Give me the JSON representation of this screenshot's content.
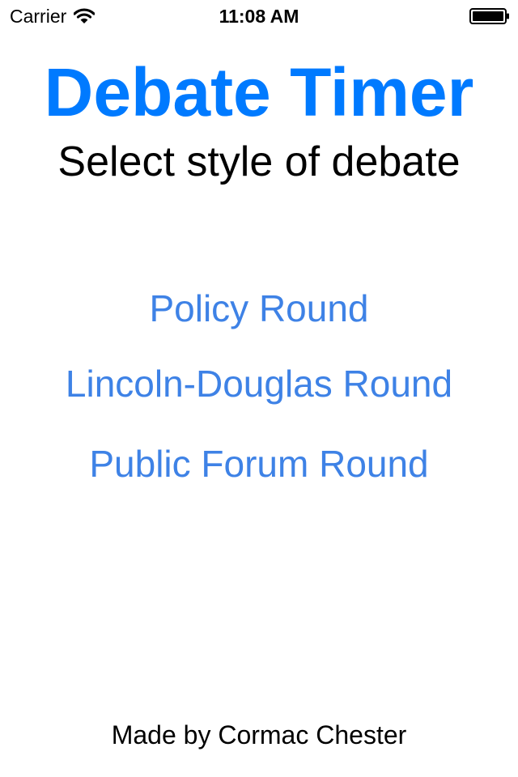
{
  "status_bar": {
    "carrier": "Carrier",
    "time": "11:08 AM",
    "icons": [
      "wifi-icon",
      "battery-icon"
    ]
  },
  "header": {
    "title": "Debate Timer",
    "subtitle": "Select style of debate"
  },
  "rounds": [
    {
      "label": "Policy Round"
    },
    {
      "label": "Lincoln-Douglas Round"
    },
    {
      "label": "Public Forum Round"
    }
  ],
  "footer": {
    "credit": "Made by Cormac Chester"
  },
  "colors": {
    "title": "#007aff",
    "button_text": "#3e82e6",
    "text": "#000000",
    "background": "#ffffff"
  }
}
